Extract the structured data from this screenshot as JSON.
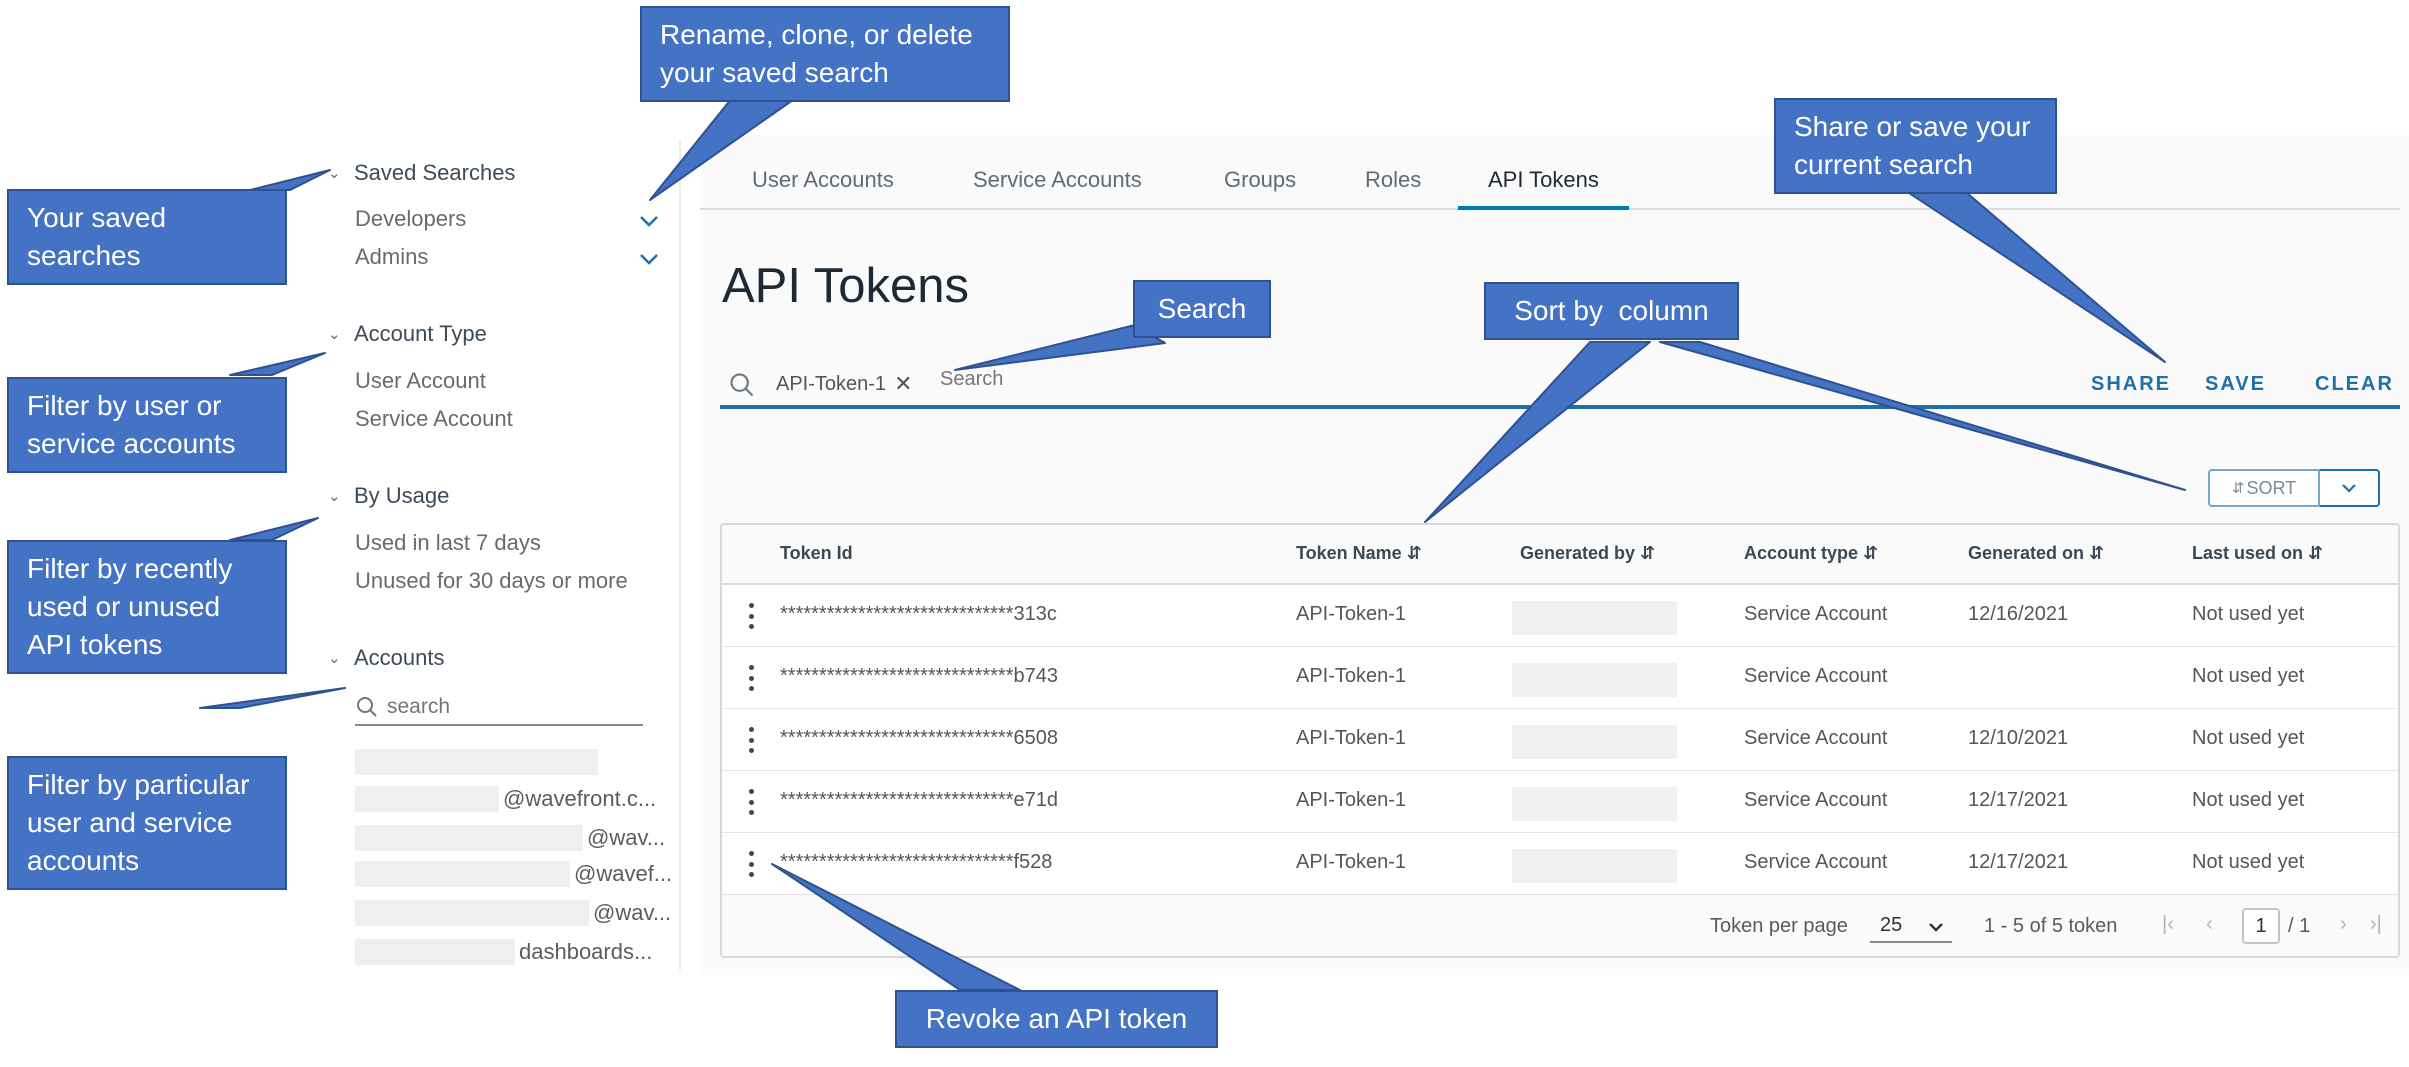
{
  "filters": {
    "saved_searches": {
      "heading": "Saved Searches",
      "items": [
        "Developers",
        "Admins"
      ]
    },
    "account_type": {
      "heading": "Account Type",
      "items": [
        "User Account",
        "Service Account"
      ]
    },
    "by_usage": {
      "heading": "By Usage",
      "items": [
        "Used in last 7 days",
        "Unused for 30 days or more"
      ]
    },
    "accounts": {
      "heading": "Accounts",
      "search_placeholder": "search",
      "items": [
        "",
        "@wavefront.c...",
        "@wav...",
        "@wavef...",
        "@wav...",
        "dashboards..."
      ]
    }
  },
  "tabs": [
    {
      "label": "User Accounts",
      "active": false
    },
    {
      "label": "Service Accounts",
      "active": false
    },
    {
      "label": "Groups",
      "active": false
    },
    {
      "label": "Roles",
      "active": false
    },
    {
      "label": "API Tokens",
      "active": true
    }
  ],
  "page_title": "API Tokens",
  "search": {
    "chip": "API-Token-1",
    "placeholder": "Search",
    "actions": {
      "share": "SHARE",
      "save": "SAVE",
      "clear": "CLEAR"
    }
  },
  "sort_button": "SORT",
  "table": {
    "columns": [
      "Token Id",
      "Token Name",
      "Generated by",
      "Account type",
      "Generated on",
      "Last used on"
    ],
    "rows": [
      {
        "token_id": "******************************313c",
        "token_name": "API-Token-1",
        "account_type": "Service Account",
        "generated_on": "12/16/2021",
        "last_used": "Not used yet"
      },
      {
        "token_id": "******************************b743",
        "token_name": "API-Token-1",
        "account_type": "Service Account",
        "generated_on": "",
        "last_used": "Not used yet"
      },
      {
        "token_id": "******************************6508",
        "token_name": "API-Token-1",
        "account_type": "Service Account",
        "generated_on": "12/10/2021",
        "last_used": "Not used yet"
      },
      {
        "token_id": "******************************e71d",
        "token_name": "API-Token-1",
        "account_type": "Service Account",
        "generated_on": "12/17/2021",
        "last_used": "Not used yet"
      },
      {
        "token_id": "******************************f528",
        "token_name": "API-Token-1",
        "account_type": "Service Account",
        "generated_on": "12/17/2021",
        "last_used": "Not used yet"
      }
    ],
    "footer": {
      "per_page_label": "Token per page",
      "per_page_value": "25",
      "range": "1 - 5 of 5 token",
      "page": "1",
      "total_pages": "/ 1"
    }
  },
  "callouts": {
    "saved": "Your saved searches",
    "rename": "Rename, clone, or delete your saved search",
    "filter_user": "Filter by user or service accounts",
    "filter_usage": "Filter by recently used or unused API tokens",
    "filter_particular": "Filter by particular user and service accounts",
    "search": "Search",
    "sort_by": "Sort by  column",
    "share_save": "Share or save your current search",
    "revoke": "Revoke an API token"
  },
  "colors": {
    "callout_fill": "#4472c4",
    "callout_border": "#2f528f",
    "accent": "#0079b8",
    "link": "#1f6fa8"
  }
}
